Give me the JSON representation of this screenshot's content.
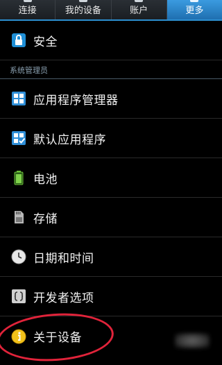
{
  "tabs": [
    {
      "label": "连接",
      "icon": "wifi-icon"
    },
    {
      "label": "我的设备",
      "icon": "device-icon"
    },
    {
      "label": "账户",
      "icon": "account-icon"
    },
    {
      "label": "更多",
      "icon": "more-icon",
      "active": true
    }
  ],
  "items": {
    "security": {
      "label": "安全",
      "icon": "lock-icon"
    },
    "section_header": "系统管理员",
    "app_manager": {
      "label": "应用程序管理器",
      "icon": "grid-icon"
    },
    "default_apps": {
      "label": "默认应用程序",
      "icon": "grid-check-icon"
    },
    "battery": {
      "label": "电池",
      "icon": "battery-icon"
    },
    "storage": {
      "label": "存储",
      "icon": "sd-card-icon"
    },
    "datetime": {
      "label": "日期和时间",
      "icon": "clock-icon"
    },
    "developer": {
      "label": "开发者选项",
      "icon": "braces-icon"
    },
    "about": {
      "label": "关于设备",
      "icon": "info-icon"
    }
  },
  "colors": {
    "accent": "#2c8fd0",
    "annotation": "#e0233a",
    "background": "#000000"
  }
}
